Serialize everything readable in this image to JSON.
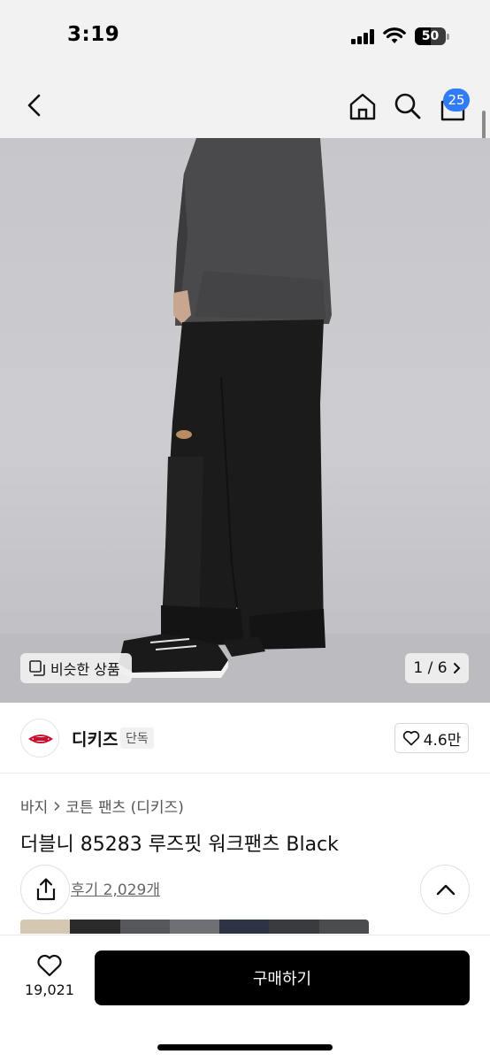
{
  "status_bar": {
    "time": "3:19",
    "battery": "50",
    "battery_level": 0.5
  },
  "nav": {
    "cart_count": "25"
  },
  "hero": {
    "similar_label": "비슷한 상품",
    "page_indicator": "1 / 6"
  },
  "brand": {
    "name": "디키즈",
    "tag": "단독",
    "likes": "4.6만"
  },
  "product": {
    "breadcrumb": [
      "바지",
      "코튼 팬츠 (디키즈)"
    ],
    "title": "더블니 85283 루즈핏 워크팬츠 Black",
    "reviews": "후기 2,029개"
  },
  "bottom": {
    "wish_count": "19,021",
    "buy_label": "구매하기"
  },
  "colors": {
    "badge": "#2f7cf6",
    "buy_button": "#000000"
  },
  "icons": [
    "back-icon",
    "home-icon",
    "search-icon",
    "cart-icon",
    "similar-items-icon",
    "chevron-right-icon",
    "heart-icon",
    "share-icon",
    "chevron-up-icon"
  ]
}
